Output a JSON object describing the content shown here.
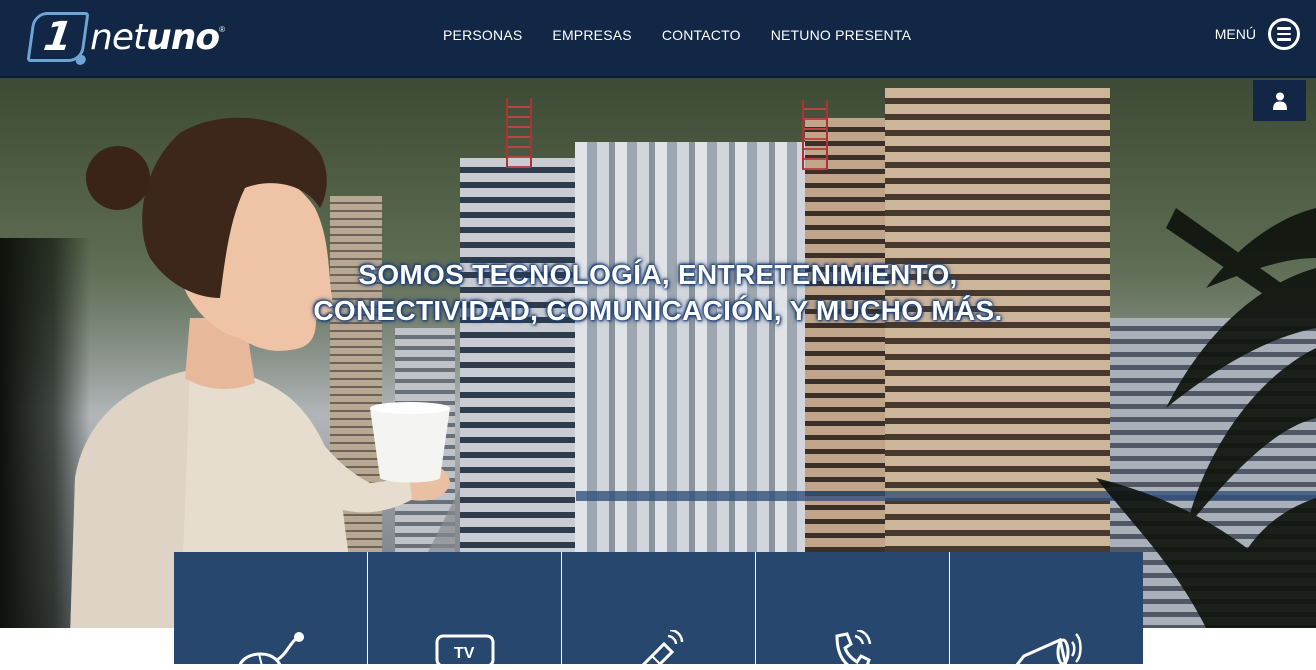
{
  "brand": {
    "logo_alt": "netuno",
    "accent": "#6fa5d6",
    "header_bg": "#112745"
  },
  "nav": {
    "items": [
      {
        "label": "PERSONAS"
      },
      {
        "label": "EMPRESAS"
      },
      {
        "label": "CONTACTO"
      },
      {
        "label": "NETUNO PRESENTA"
      }
    ]
  },
  "menu": {
    "label": "MENÚ",
    "icon": "hamburger-circle-icon"
  },
  "user_button": {
    "icon": "user-icon"
  },
  "hero": {
    "tagline_line1": "SOMOS TECNOLOGÍA, ENTRETENIMIENTO,",
    "tagline_line2": "CONECTIVIDAD, COMUNICACIÓN, Y MUCHO MÁS."
  },
  "services": [
    {
      "icon": "internet-mouse-icon"
    },
    {
      "icon": "tv-icon"
    },
    {
      "icon": "satellite-icon"
    },
    {
      "icon": "phone-icon"
    },
    {
      "icon": "megaphone-icon"
    }
  ],
  "colors": {
    "service_tile": "#27476f",
    "tagline_glow": "#1d3f73"
  }
}
